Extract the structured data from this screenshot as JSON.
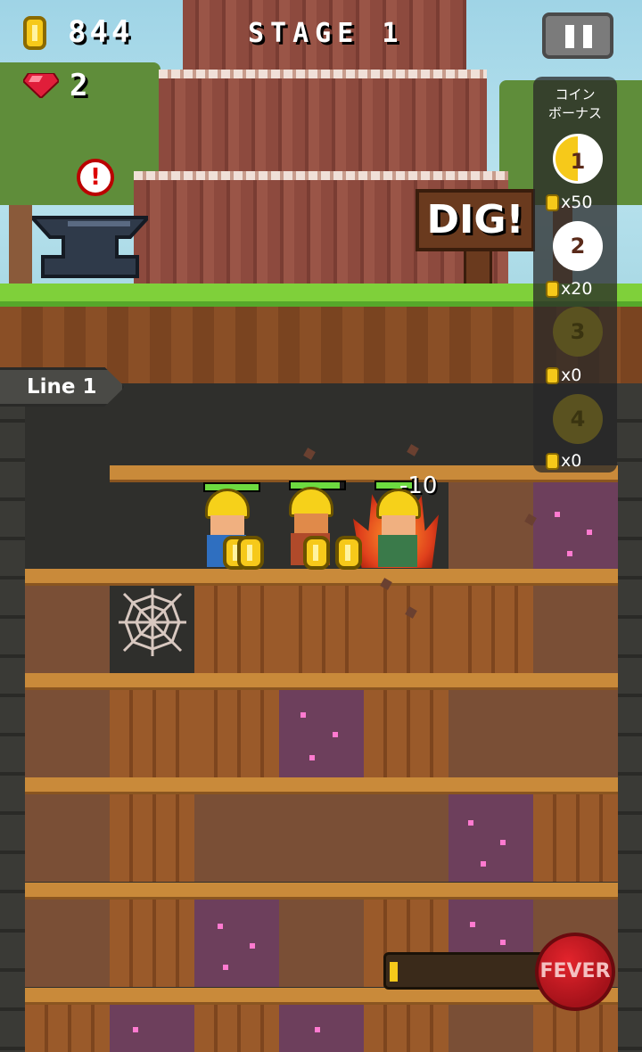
{
  "hud": {
    "coins": "844",
    "gems": "2",
    "stage_title": "STAGE 1"
  },
  "bonus_panel": {
    "title_line1": "コイン",
    "title_line2": "ボーナス",
    "slots": [
      {
        "number": "1",
        "multiplier": "x50"
      },
      {
        "number": "2",
        "multiplier": "x20"
      },
      {
        "number": "3",
        "multiplier": "x0"
      },
      {
        "number": "4",
        "multiplier": "x0"
      }
    ]
  },
  "sign": {
    "dig_label": "DIG!"
  },
  "line_label": "Line 1",
  "alert_mark": "!",
  "damage_text": "-10",
  "fever": {
    "label": "FEVER",
    "progress": 0.05
  },
  "colors": {
    "coin": "#f6c91a",
    "gem": "#e01e3a",
    "grass": "#7fd03a",
    "fever": "#c4161e"
  },
  "icons": [
    "coin-icon",
    "gem-icon",
    "pause-icon",
    "alert-icon",
    "anvil-icon",
    "spider-web-icon"
  ]
}
